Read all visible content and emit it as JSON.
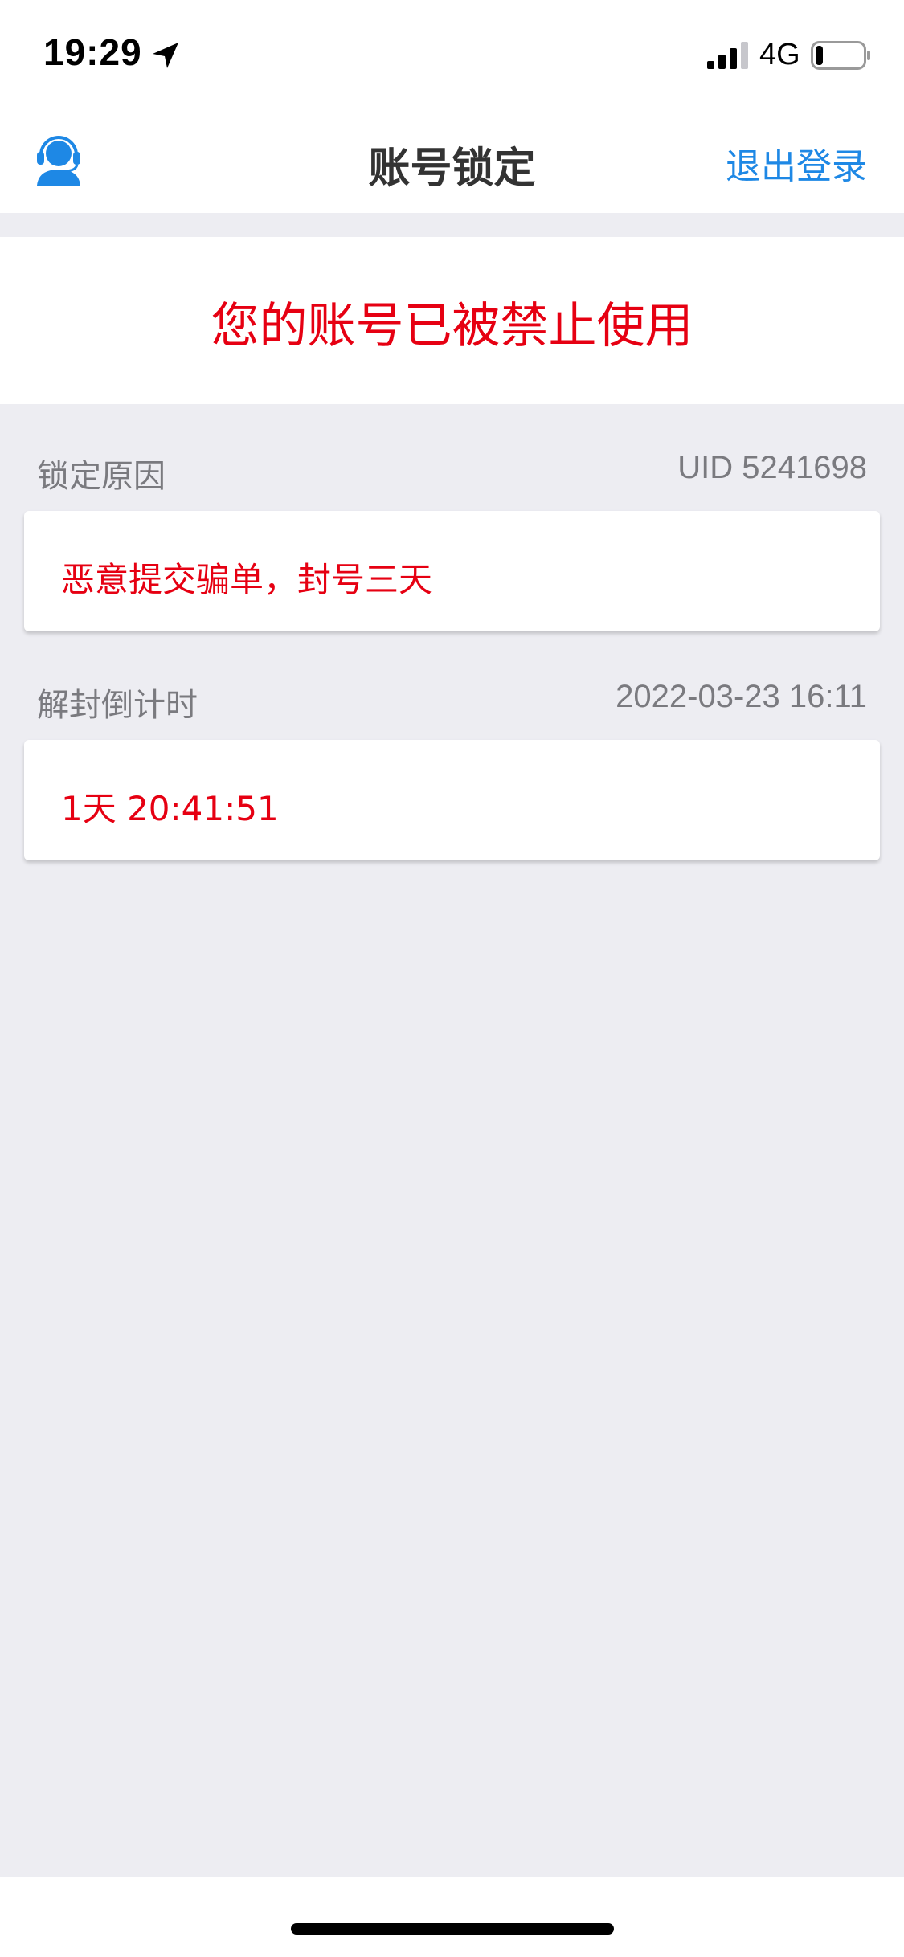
{
  "status_bar": {
    "time": "19:29",
    "network": "4G",
    "location_icon": "location-arrow-icon",
    "signal_icon": "cellular-signal-icon",
    "battery_icon": "battery-icon",
    "battery_level_percent": 15
  },
  "nav": {
    "support_icon": "customer-support-icon",
    "title": "账号锁定",
    "logout_label": "退出登录"
  },
  "banner": {
    "message": "您的账号已被禁止使用"
  },
  "lock_reason": {
    "label": "锁定原因",
    "uid": "UID 5241698",
    "reason": "恶意提交骗单，封号三天"
  },
  "countdown": {
    "label": "解封倒计时",
    "unlock_time": "2022-03-23 16:11",
    "remaining": "1天 20:41:51"
  },
  "colors": {
    "accent_blue": "#1e88e5",
    "alert_red": "#e60012",
    "background": "#ededf2",
    "secondary_text": "#7a7a7f"
  }
}
